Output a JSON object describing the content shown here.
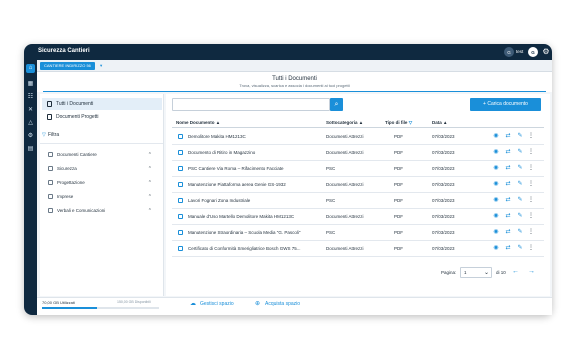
{
  "app": {
    "title": "Sicurezza Cantieri",
    "user_initial": "G",
    "user_label": "test",
    "avatar_initial": "G"
  },
  "project_tab": {
    "label": "CANTIERE INDIRIZZO 56"
  },
  "header": {
    "title": "Tutti i Documenti",
    "subtitle": "Trova, visualizza, scarica e associa i documenti ai tuoi progetti"
  },
  "sidebar": {
    "nav": [
      {
        "label": "Tutti i Documenti"
      },
      {
        "label": "Documenti Progetti"
      }
    ],
    "filter_label": "Filtra",
    "filters": [
      {
        "label": "Documenti Cantiere"
      },
      {
        "label": "Sicurezza"
      },
      {
        "label": "Progettazione"
      },
      {
        "label": "Imprese"
      },
      {
        "label": "Verbali e Comunicazioni"
      }
    ]
  },
  "toolbar": {
    "search_placeholder": "",
    "upload_label": "+ Carica documento"
  },
  "table": {
    "columns": [
      "Nome Documento",
      "Sottocategoria",
      "Tipo di file",
      "Data"
    ],
    "rows": [
      {
        "name": "Demolitore Makita HM1213C",
        "sub": "Documenti Attrezzi",
        "type": "PDF",
        "date": "07/03/2023"
      },
      {
        "name": "Documento di Ritiro in Magazzino",
        "sub": "Documenti Attrezzi",
        "type": "PDF",
        "date": "07/03/2023"
      },
      {
        "name": "PSC Cantiere Via Roma – Rifacimento Facciate",
        "sub": "PSC",
        "type": "PDF",
        "date": "07/03/2023"
      },
      {
        "name": "Manutenzione Piattaforma aerea Genie GS-1932",
        "sub": "Documenti Attrezzi",
        "type": "PDF",
        "date": "07/03/2023"
      },
      {
        "name": "Lavori Fognari Zona Industriale",
        "sub": "PSC",
        "type": "PDF",
        "date": "07/03/2023"
      },
      {
        "name": "Manuale d'Uso Martello Demolitore Makita HM1213C",
        "sub": "Documenti Attrezzi",
        "type": "PDF",
        "date": "07/03/2023"
      },
      {
        "name": "Manutenzione Straordinaria – Scuola Media \"G. Pascoli\"",
        "sub": "PSC",
        "type": "PDF",
        "date": "07/03/2023"
      },
      {
        "name": "Certificato di Conformità Smerigliatrice Bosch GWS 75...",
        "sub": "Documenti Attrezzi",
        "type": "PDF",
        "date": "07/03/2023"
      }
    ]
  },
  "pager": {
    "label": "Pagina:",
    "value": "1",
    "of": "di 10"
  },
  "footer": {
    "used": "70,00 GB Utilizzati",
    "available": "150,00 GB Disponibili",
    "used_fraction": 0.47,
    "manage": "Gestisci spazio",
    "buy": "Acquista spazio"
  },
  "colors": {
    "primary": "#1a8fd9",
    "dark": "#0f2940"
  }
}
